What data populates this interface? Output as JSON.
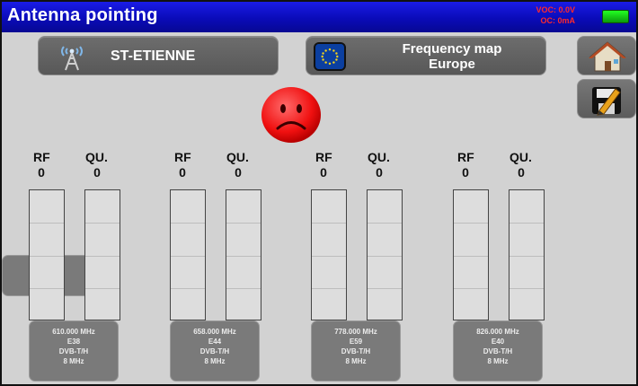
{
  "titlebar": {
    "title": "Antenna pointing",
    "status_line1": "VOC: 0.0V",
    "status_line2": "OC: 0mA",
    "battery_color": "#18d818"
  },
  "location_button": {
    "label": "ST-ETIENNE",
    "icon": "antenna-icon"
  },
  "frequency_map_button": {
    "line1": "Frequency map",
    "line2": "Europe",
    "icon": "eu-flag-icon"
  },
  "side_buttons": {
    "home": {
      "icon": "home-icon"
    },
    "save": {
      "icon": "save-edit-icon"
    },
    "info": {
      "icon": "info-icon"
    }
  },
  "status_indicator": {
    "icon": "sad-face-icon",
    "color": "#ff1c1c"
  },
  "channels": [
    {
      "rf_label": "RF",
      "rf_value": "0",
      "qu_label": "QU.",
      "qu_value": "0",
      "rf_level": 0,
      "qu_level": 0,
      "freq": "610.000 MHz",
      "chan": "E38",
      "standard": "DVB-T/H",
      "bandwidth": "8 MHz"
    },
    {
      "rf_label": "RF",
      "rf_value": "0",
      "qu_label": "QU.",
      "qu_value": "0",
      "rf_level": 0,
      "qu_level": 0,
      "freq": "658.000 MHz",
      "chan": "E44",
      "standard": "DVB-T/H",
      "bandwidth": "8 MHz"
    },
    {
      "rf_label": "RF",
      "rf_value": "0",
      "qu_label": "QU.",
      "qu_value": "0",
      "rf_level": 0,
      "qu_level": 0,
      "freq": "778.000 MHz",
      "chan": "E59",
      "standard": "DVB-T/H",
      "bandwidth": "8 MHz"
    },
    {
      "rf_label": "RF",
      "rf_value": "0",
      "qu_label": "QU.",
      "qu_value": "0",
      "rf_level": 0,
      "qu_level": 0,
      "freq": "826.000 MHz",
      "chan": "E40",
      "standard": "DVB-T/H",
      "bandwidth": "8 MHz"
    }
  ]
}
